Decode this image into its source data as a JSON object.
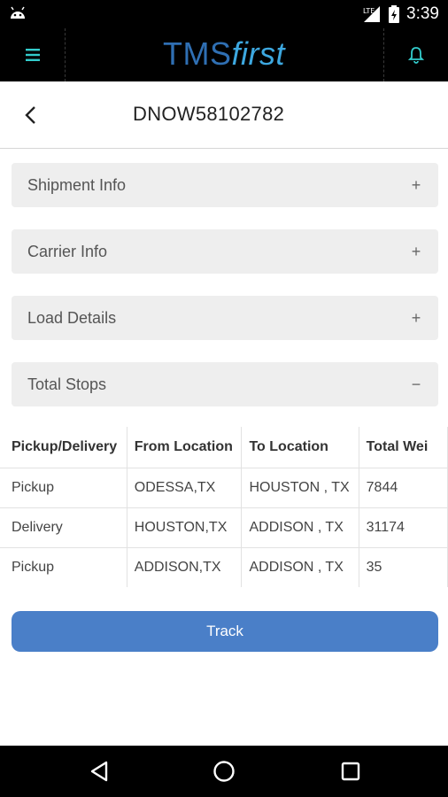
{
  "status_bar": {
    "time": "3:39",
    "icons": [
      "android-icon",
      "signal-icon",
      "battery-icon"
    ]
  },
  "header": {
    "logo_prefix": "TMS",
    "logo_suffix": "first",
    "menu_icon": "hamburger-icon",
    "notification_icon": "bell-icon"
  },
  "page": {
    "title": "DNOW58102782"
  },
  "sections": [
    {
      "label": "Shipment Info",
      "toggle": "+"
    },
    {
      "label": "Carrier Info",
      "toggle": "+"
    },
    {
      "label": "Load Details",
      "toggle": "+"
    },
    {
      "label": "Total Stops",
      "toggle": "−"
    }
  ],
  "stops_table": {
    "headers": [
      "Pickup/Delivery",
      "From Location",
      "To Location",
      "Total Wei"
    ],
    "rows": [
      [
        "Pickup",
        "ODESSA,TX",
        "HOUSTON , TX",
        "7844"
      ],
      [
        "Delivery",
        "HOUSTON,TX",
        "ADDISON , TX",
        "31174"
      ],
      [
        "Pickup",
        "ADDISON,TX",
        "ADDISON , TX",
        "35"
      ]
    ]
  },
  "actions": {
    "track_label": "Track"
  },
  "colors": {
    "header_bg": "#000000",
    "logo_blue": "#2f6fb3",
    "logo_accent": "#3da8e0",
    "icon_teal": "#33cccc",
    "button_blue": "#4a7fc8",
    "section_bg": "#eeeeee"
  }
}
